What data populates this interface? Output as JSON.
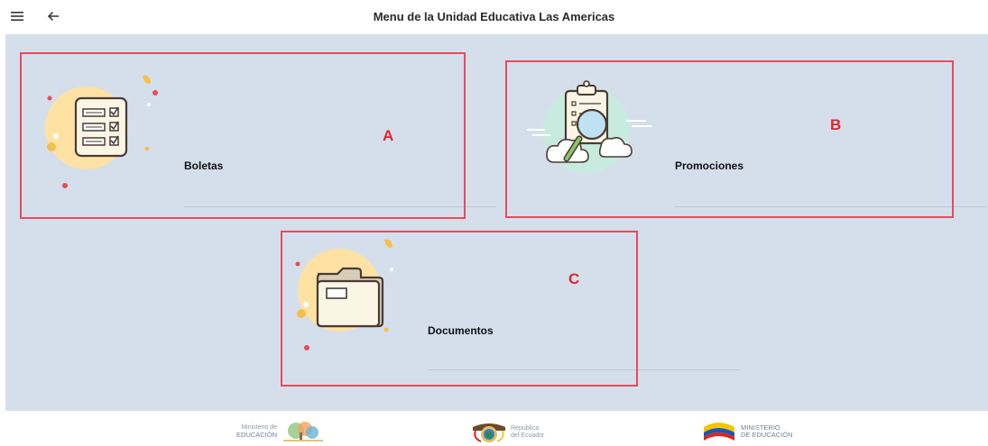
{
  "header": {
    "title": "Menu de la Unidad Educativa Las Americas",
    "menu_icon": "hamburger-icon",
    "back_icon": "arrow-left-icon"
  },
  "menu": {
    "items": [
      {
        "label": "Boletas",
        "icon": "checklist-icon",
        "annotation": "A"
      },
      {
        "label": "Promociones",
        "icon": "clipboard-magnifier-icon",
        "annotation": "B"
      },
      {
        "label": "Documentos",
        "icon": "folder-icon",
        "annotation": "C"
      }
    ]
  },
  "footer": {
    "logos": [
      {
        "line1": "Ministerio de",
        "line2": "EDUCACIÓN"
      },
      {
        "line1": "República",
        "line2": "del Ecuador"
      },
      {
        "line1": "MINISTERIO",
        "line2": "DE EDUCACIÓN"
      }
    ]
  },
  "colors": {
    "background": "#d5dfec",
    "annotation": "#e84b5a",
    "icon_circle": "#fde2a3",
    "accent": "#1565c0"
  }
}
